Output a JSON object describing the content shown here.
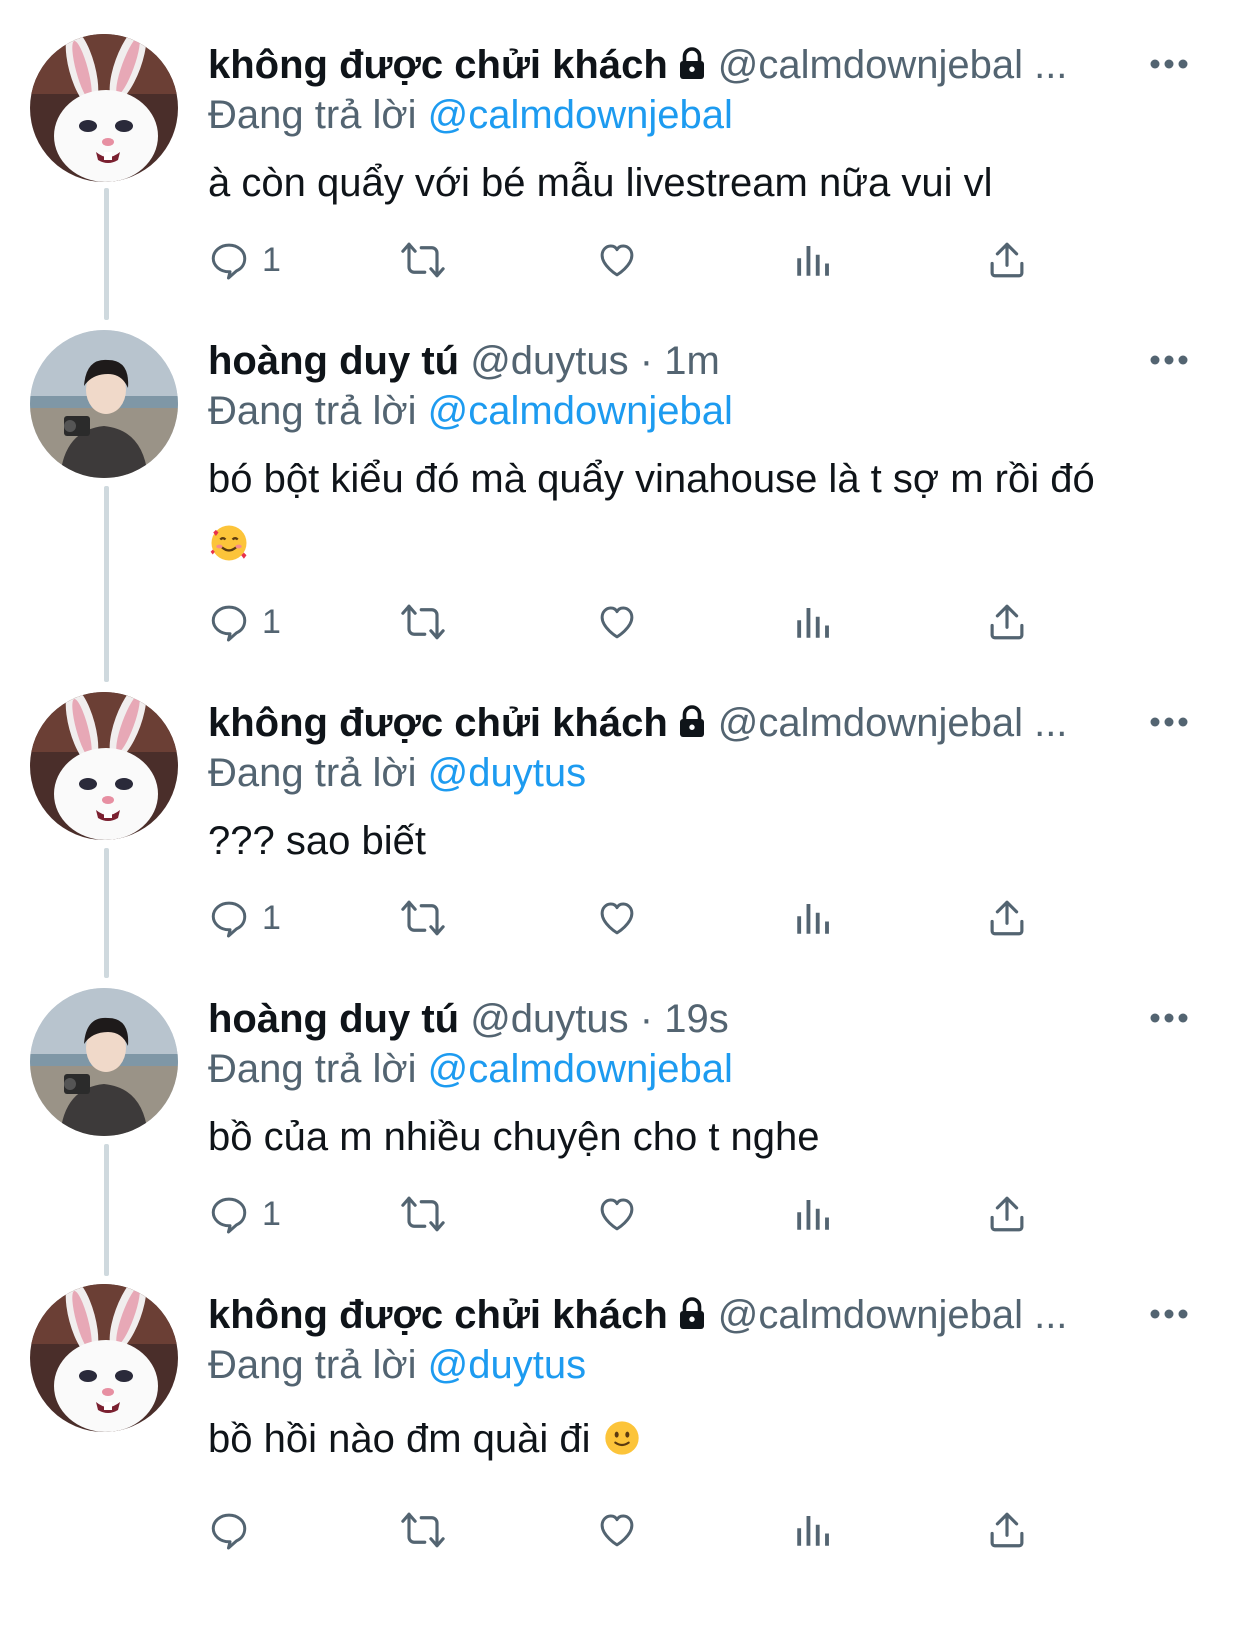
{
  "colors": {
    "text": "#0f1419",
    "muted": "#536471",
    "link": "#1d9bf0",
    "thread_line": "#cfd9de"
  },
  "icons": [
    "lock-icon",
    "more-icon",
    "reply-icon",
    "retweet-icon",
    "like-icon",
    "views-icon",
    "share-icon",
    "smiling-face-with-hearts-emoji",
    "slightly-smiling-face-emoji"
  ],
  "replying_label": "Đang trả lời",
  "tweets": [
    {
      "name": "không được chửi khách",
      "handle": "@calmdownjebal ...",
      "replying_to": "@calmdownjebal",
      "text": "à còn quẩy với bé mẫu livestream nữa vui vl",
      "reply_count": "1"
    },
    {
      "name": "hoàng duy tú",
      "handle": "@duytus · 1m",
      "replying_to": "@calmdownjebal",
      "text": "bó bột kiểu đó mà quẩy vinahouse là t sợ m rồi đó",
      "reply_count": "1"
    },
    {
      "name": "không được chửi khách",
      "handle": "@calmdownjebal ...",
      "replying_to": "@duytus",
      "text": "??? sao biết",
      "reply_count": "1"
    },
    {
      "name": "hoàng duy tú",
      "handle": "@duytus · 19s",
      "replying_to": "@calmdownjebal",
      "text": "bồ của m nhiều chuyện cho t nghe",
      "reply_count": "1"
    },
    {
      "name": "không được chửi khách",
      "handle": "@calmdownjebal ...",
      "replying_to": "@duytus",
      "text": "bồ hồi nào đm quài đi",
      "reply_count": ""
    }
  ]
}
